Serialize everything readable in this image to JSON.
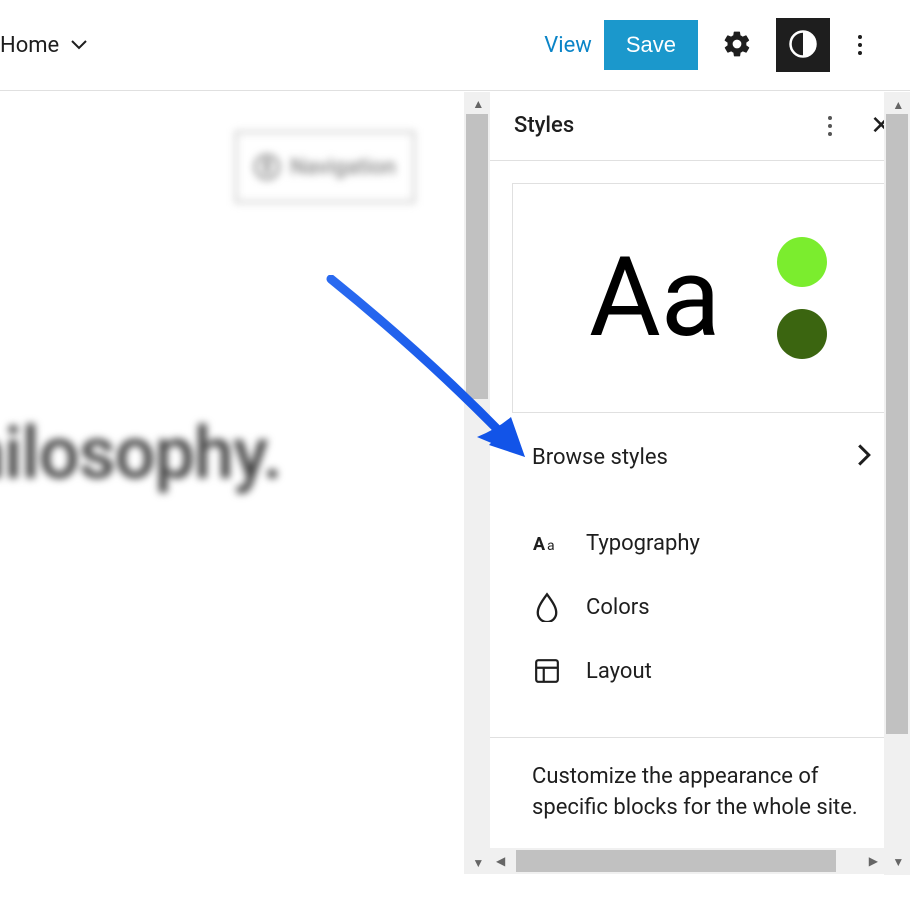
{
  "topbar": {
    "home_label": "Home",
    "view_label": "View",
    "save_label": "Save"
  },
  "canvas": {
    "nav_badge_label": "Navigation",
    "heading_text": "hilosophy."
  },
  "styles_panel": {
    "title": "Styles",
    "preview_sample": "Aa",
    "swatch_colors": {
      "primary": "#7bed2e",
      "secondary": "#3b6510"
    },
    "browse_label": "Browse styles",
    "items": [
      {
        "label": "Typography",
        "icon": "typography-icon"
      },
      {
        "label": "Colors",
        "icon": "colors-icon"
      },
      {
        "label": "Layout",
        "icon": "layout-icon"
      }
    ],
    "description": "Customize the appearance of specific blocks for the whole site."
  }
}
